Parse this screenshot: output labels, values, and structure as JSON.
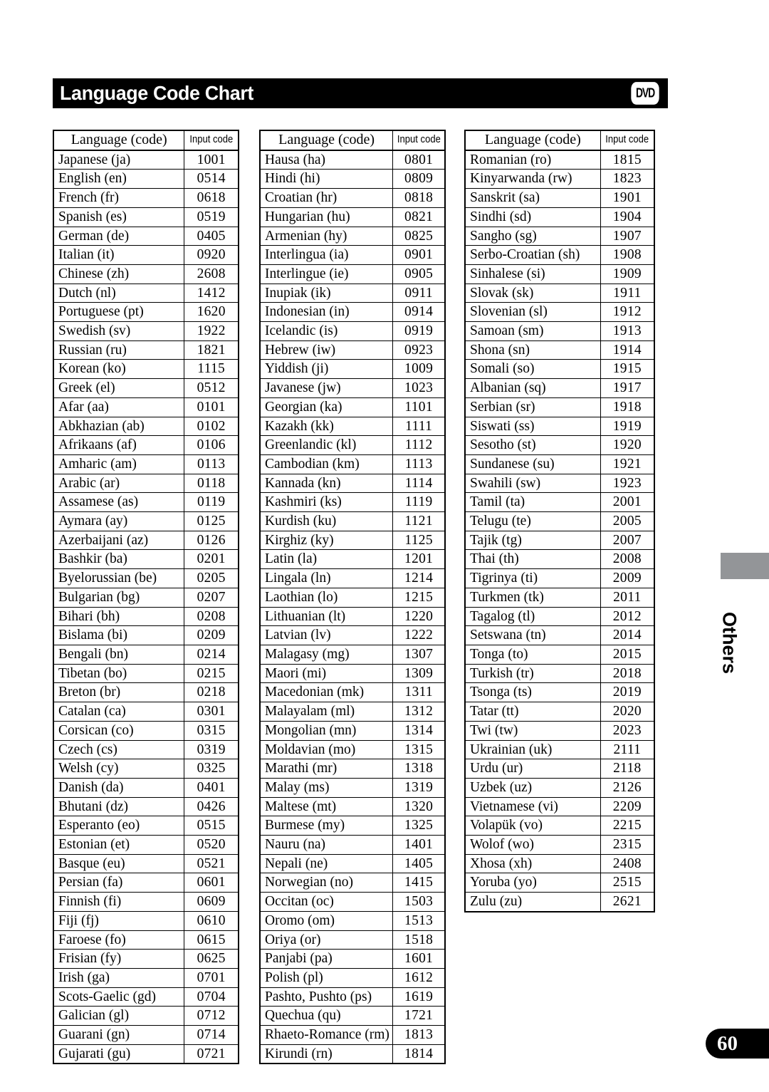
{
  "page": {
    "title": "Language Code Chart",
    "media_badge": "DVD",
    "side_section_label": "Others",
    "page_number": "60",
    "accent_black": "#000000",
    "side_tab_gray": "#939598"
  },
  "table_headers": {
    "language": "Language (code)",
    "input_code": "Input code"
  },
  "chart_data": {
    "type": "table",
    "title": "Language Code Chart",
    "columns": [
      "Language (code)",
      "Input code"
    ],
    "tables": [
      {
        "rows": [
          [
            "Japanese (ja)",
            "1001"
          ],
          [
            "English (en)",
            "0514"
          ],
          [
            "French (fr)",
            "0618"
          ],
          [
            "Spanish (es)",
            "0519"
          ],
          [
            "German (de)",
            "0405"
          ],
          [
            "Italian (it)",
            "0920"
          ],
          [
            "Chinese (zh)",
            "2608"
          ],
          [
            "Dutch (nl)",
            "1412"
          ],
          [
            "Portuguese (pt)",
            "1620"
          ],
          [
            "Swedish (sv)",
            "1922"
          ],
          [
            "Russian (ru)",
            "1821"
          ],
          [
            "Korean (ko)",
            "1115"
          ],
          [
            "Greek (el)",
            "0512"
          ],
          [
            "Afar (aa)",
            "0101"
          ],
          [
            "Abkhazian (ab)",
            "0102"
          ],
          [
            "Afrikaans (af)",
            "0106"
          ],
          [
            "Amharic (am)",
            "0113"
          ],
          [
            "Arabic (ar)",
            "0118"
          ],
          [
            "Assamese (as)",
            "0119"
          ],
          [
            "Aymara (ay)",
            "0125"
          ],
          [
            "Azerbaijani (az)",
            "0126"
          ],
          [
            "Bashkir (ba)",
            "0201"
          ],
          [
            "Byelorussian (be)",
            "0205"
          ],
          [
            "Bulgarian (bg)",
            "0207"
          ],
          [
            "Bihari (bh)",
            "0208"
          ],
          [
            "Bislama (bi)",
            "0209"
          ],
          [
            "Bengali (bn)",
            "0214"
          ],
          [
            "Tibetan (bo)",
            "0215"
          ],
          [
            "Breton (br)",
            "0218"
          ],
          [
            "Catalan (ca)",
            "0301"
          ],
          [
            "Corsican (co)",
            "0315"
          ],
          [
            "Czech (cs)",
            "0319"
          ],
          [
            "Welsh (cy)",
            "0325"
          ],
          [
            "Danish (da)",
            "0401"
          ],
          [
            "Bhutani (dz)",
            "0426"
          ],
          [
            "Esperanto (eo)",
            "0515"
          ],
          [
            "Estonian (et)",
            "0520"
          ],
          [
            "Basque (eu)",
            "0521"
          ],
          [
            "Persian (fa)",
            "0601"
          ],
          [
            "Finnish (fi)",
            "0609"
          ],
          [
            "Fiji (fj)",
            "0610"
          ],
          [
            "Faroese (fo)",
            "0615"
          ],
          [
            "Frisian (fy)",
            "0625"
          ],
          [
            "Irish (ga)",
            "0701"
          ],
          [
            "Scots-Gaelic (gd)",
            "0704"
          ],
          [
            "Galician (gl)",
            "0712"
          ],
          [
            "Guarani (gn)",
            "0714"
          ],
          [
            "Gujarati (gu)",
            "0721"
          ]
        ]
      },
      {
        "rows": [
          [
            "Hausa (ha)",
            "0801"
          ],
          [
            "Hindi (hi)",
            "0809"
          ],
          [
            "Croatian (hr)",
            "0818"
          ],
          [
            "Hungarian (hu)",
            "0821"
          ],
          [
            "Armenian (hy)",
            "0825"
          ],
          [
            "Interlingua (ia)",
            "0901"
          ],
          [
            "Interlingue (ie)",
            "0905"
          ],
          [
            "Inupiak (ik)",
            "0911"
          ],
          [
            "Indonesian (in)",
            "0914"
          ],
          [
            "Icelandic (is)",
            "0919"
          ],
          [
            "Hebrew (iw)",
            "0923"
          ],
          [
            "Yiddish (ji)",
            "1009"
          ],
          [
            "Javanese (jw)",
            "1023"
          ],
          [
            "Georgian (ka)",
            "1101"
          ],
          [
            "Kazakh (kk)",
            "1111"
          ],
          [
            "Greenlandic (kl)",
            "1112"
          ],
          [
            "Cambodian (km)",
            "1113"
          ],
          [
            "Kannada (kn)",
            "1114"
          ],
          [
            "Kashmiri (ks)",
            "1119"
          ],
          [
            "Kurdish (ku)",
            "1121"
          ],
          [
            "Kirghiz (ky)",
            "1125"
          ],
          [
            "Latin (la)",
            "1201"
          ],
          [
            "Lingala (ln)",
            "1214"
          ],
          [
            "Laothian (lo)",
            "1215"
          ],
          [
            "Lithuanian (lt)",
            "1220"
          ],
          [
            "Latvian (lv)",
            "1222"
          ],
          [
            "Malagasy (mg)",
            "1307"
          ],
          [
            "Maori (mi)",
            "1309"
          ],
          [
            "Macedonian (mk)",
            "1311"
          ],
          [
            "Malayalam (ml)",
            "1312"
          ],
          [
            "Mongolian (mn)",
            "1314"
          ],
          [
            "Moldavian (mo)",
            "1315"
          ],
          [
            "Marathi (mr)",
            "1318"
          ],
          [
            "Malay (ms)",
            "1319"
          ],
          [
            "Maltese (mt)",
            "1320"
          ],
          [
            "Burmese (my)",
            "1325"
          ],
          [
            "Nauru (na)",
            "1401"
          ],
          [
            "Nepali (ne)",
            "1405"
          ],
          [
            "Norwegian (no)",
            "1415"
          ],
          [
            "Occitan (oc)",
            "1503"
          ],
          [
            "Oromo (om)",
            "1513"
          ],
          [
            "Oriya (or)",
            "1518"
          ],
          [
            "Panjabi (pa)",
            "1601"
          ],
          [
            "Polish (pl)",
            "1612"
          ],
          [
            "Pashto, Pushto (ps)",
            "1619"
          ],
          [
            "Quechua (qu)",
            "1721"
          ],
          [
            "Rhaeto-Romance (rm)",
            "1813"
          ],
          [
            "Kirundi (rn)",
            "1814"
          ]
        ]
      },
      {
        "rows": [
          [
            "Romanian (ro)",
            "1815"
          ],
          [
            "Kinyarwanda (rw)",
            "1823"
          ],
          [
            "Sanskrit (sa)",
            "1901"
          ],
          [
            "Sindhi (sd)",
            "1904"
          ],
          [
            "Sangho (sg)",
            "1907"
          ],
          [
            "Serbo-Croatian (sh)",
            "1908"
          ],
          [
            "Sinhalese (si)",
            "1909"
          ],
          [
            "Slovak (sk)",
            "1911"
          ],
          [
            "Slovenian (sl)",
            "1912"
          ],
          [
            "Samoan (sm)",
            "1913"
          ],
          [
            "Shona (sn)",
            "1914"
          ],
          [
            "Somali (so)",
            "1915"
          ],
          [
            "Albanian (sq)",
            "1917"
          ],
          [
            "Serbian (sr)",
            "1918"
          ],
          [
            "Siswati (ss)",
            "1919"
          ],
          [
            "Sesotho (st)",
            "1920"
          ],
          [
            "Sundanese (su)",
            "1921"
          ],
          [
            "Swahili (sw)",
            "1923"
          ],
          [
            "Tamil (ta)",
            "2001"
          ],
          [
            "Telugu (te)",
            "2005"
          ],
          [
            "Tajik (tg)",
            "2007"
          ],
          [
            "Thai (th)",
            "2008"
          ],
          [
            "Tigrinya (ti)",
            "2009"
          ],
          [
            "Turkmen (tk)",
            "2011"
          ],
          [
            "Tagalog (tl)",
            "2012"
          ],
          [
            "Setswana (tn)",
            "2014"
          ],
          [
            "Tonga (to)",
            "2015"
          ],
          [
            "Turkish (tr)",
            "2018"
          ],
          [
            "Tsonga (ts)",
            "2019"
          ],
          [
            "Tatar (tt)",
            "2020"
          ],
          [
            "Twi (tw)",
            "2023"
          ],
          [
            "Ukrainian (uk)",
            "2111"
          ],
          [
            "Urdu (ur)",
            "2118"
          ],
          [
            "Uzbek (uz)",
            "2126"
          ],
          [
            "Vietnamese (vi)",
            "2209"
          ],
          [
            "Volapük (vo)",
            "2215"
          ],
          [
            "Wolof (wo)",
            "2315"
          ],
          [
            "Xhosa (xh)",
            "2408"
          ],
          [
            "Yoruba (yo)",
            "2515"
          ],
          [
            "Zulu (zu)",
            "2621"
          ]
        ]
      }
    ]
  }
}
